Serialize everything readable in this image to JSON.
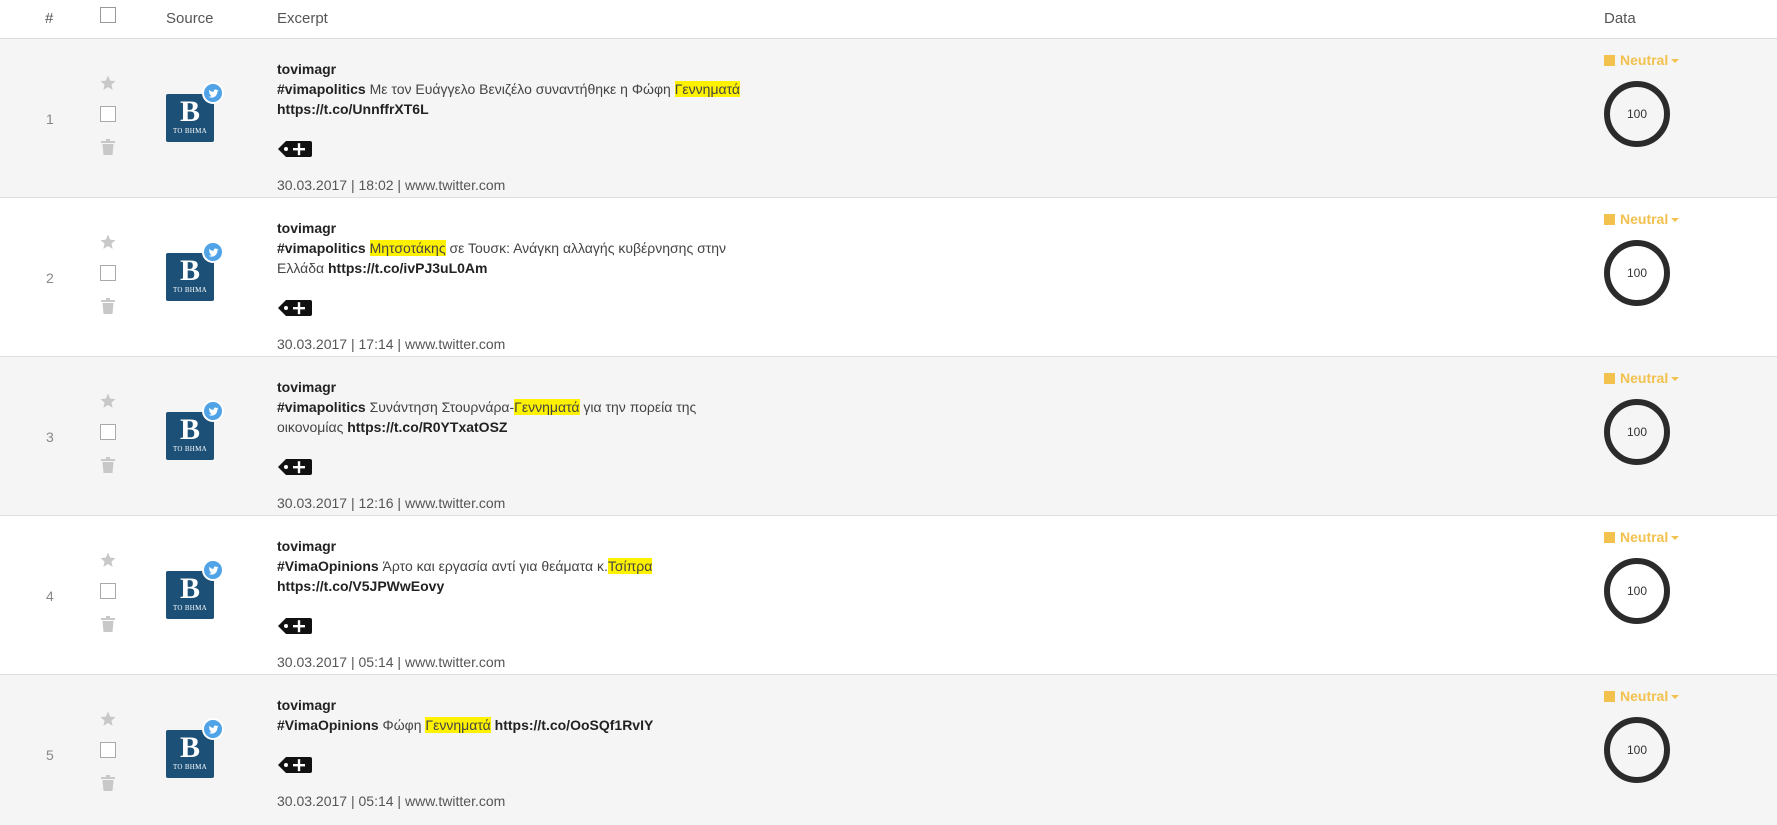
{
  "header": {
    "num": "#",
    "source": "Source",
    "excerpt": "Excerpt",
    "data": "Data"
  },
  "rows": [
    {
      "num": "1",
      "author": "tovimagr",
      "parts": [
        {
          "t": "b",
          "v": "#vimapolitics"
        },
        {
          "t": "n",
          "v": " Με τον Ευάγγελο Βενιζέλο συναντήθηκε η Φώφη "
        },
        {
          "t": "h",
          "v": "Γεννηματά"
        },
        {
          "t": "br"
        },
        {
          "t": "b",
          "v": "https://t.co/UnnffrXT6L"
        }
      ],
      "date": "30.03.2017",
      "time": "18:02",
      "domain": "www.twitter.com",
      "sentiment": "Neutral",
      "score": "100"
    },
    {
      "num": "2",
      "author": "tovimagr",
      "parts": [
        {
          "t": "b",
          "v": "#vimapolitics"
        },
        {
          "t": "n",
          "v": " "
        },
        {
          "t": "h",
          "v": "Μητσοτάκης"
        },
        {
          "t": "n",
          "v": " σε Τουσκ: Ανάγκη αλλαγής κυβέρνησης στην"
        },
        {
          "t": "br"
        },
        {
          "t": "n",
          "v": "Ελλάδα "
        },
        {
          "t": "b",
          "v": "https://t.co/ivPJ3uL0Am"
        }
      ],
      "date": "30.03.2017",
      "time": "17:14",
      "domain": "www.twitter.com",
      "sentiment": "Neutral",
      "score": "100"
    },
    {
      "num": "3",
      "author": "tovimagr",
      "parts": [
        {
          "t": "b",
          "v": "#vimapolitics"
        },
        {
          "t": "n",
          "v": " Συνάντηση Στουρνάρα-"
        },
        {
          "t": "h",
          "v": "Γεννηματά"
        },
        {
          "t": "n",
          "v": " για την πορεία της"
        },
        {
          "t": "br"
        },
        {
          "t": "n",
          "v": "οικονομίας "
        },
        {
          "t": "b",
          "v": "https://t.co/R0YTxatOSZ"
        }
      ],
      "date": "30.03.2017",
      "time": "12:16",
      "domain": "www.twitter.com",
      "sentiment": "Neutral",
      "score": "100"
    },
    {
      "num": "4",
      "author": "tovimagr",
      "parts": [
        {
          "t": "b",
          "v": "#VimaOpinions"
        },
        {
          "t": "n",
          "v": " Άρτο και εργασία αντί για θεάματα κ."
        },
        {
          "t": "h",
          "v": "Τσίπρα"
        },
        {
          "t": "br"
        },
        {
          "t": "b",
          "v": "https://t.co/V5JPWwEovy"
        }
      ],
      "date": "30.03.2017",
      "time": "05:14",
      "domain": "www.twitter.com",
      "sentiment": "Neutral",
      "score": "100"
    },
    {
      "num": "5",
      "author": "tovimagr",
      "parts": [
        {
          "t": "b",
          "v": "#VimaOpinions"
        },
        {
          "t": "n",
          "v": " Φώφη "
        },
        {
          "t": "h",
          "v": "Γεννηματά"
        },
        {
          "t": "n",
          "v": " "
        },
        {
          "t": "b",
          "v": "https://t.co/OoSQf1RvIY"
        }
      ],
      "date": "30.03.2017",
      "time": "05:14",
      "domain": "www.twitter.com",
      "sentiment": "Neutral",
      "score": "100"
    }
  ],
  "logo": {
    "letter": "B",
    "subtitle": "ΤΟ ΒΗΜΑ"
  },
  "colors": {
    "sentiment_neutral": "#f2c14e",
    "highlight": "#fff200",
    "logo_bg": "#1c5077",
    "twitter_blue": "#4fa3e6"
  },
  "icons": {
    "star": "star-icon",
    "trash": "trash-icon",
    "tag_add": "tag-add-icon",
    "twitter": "twitter-icon"
  }
}
